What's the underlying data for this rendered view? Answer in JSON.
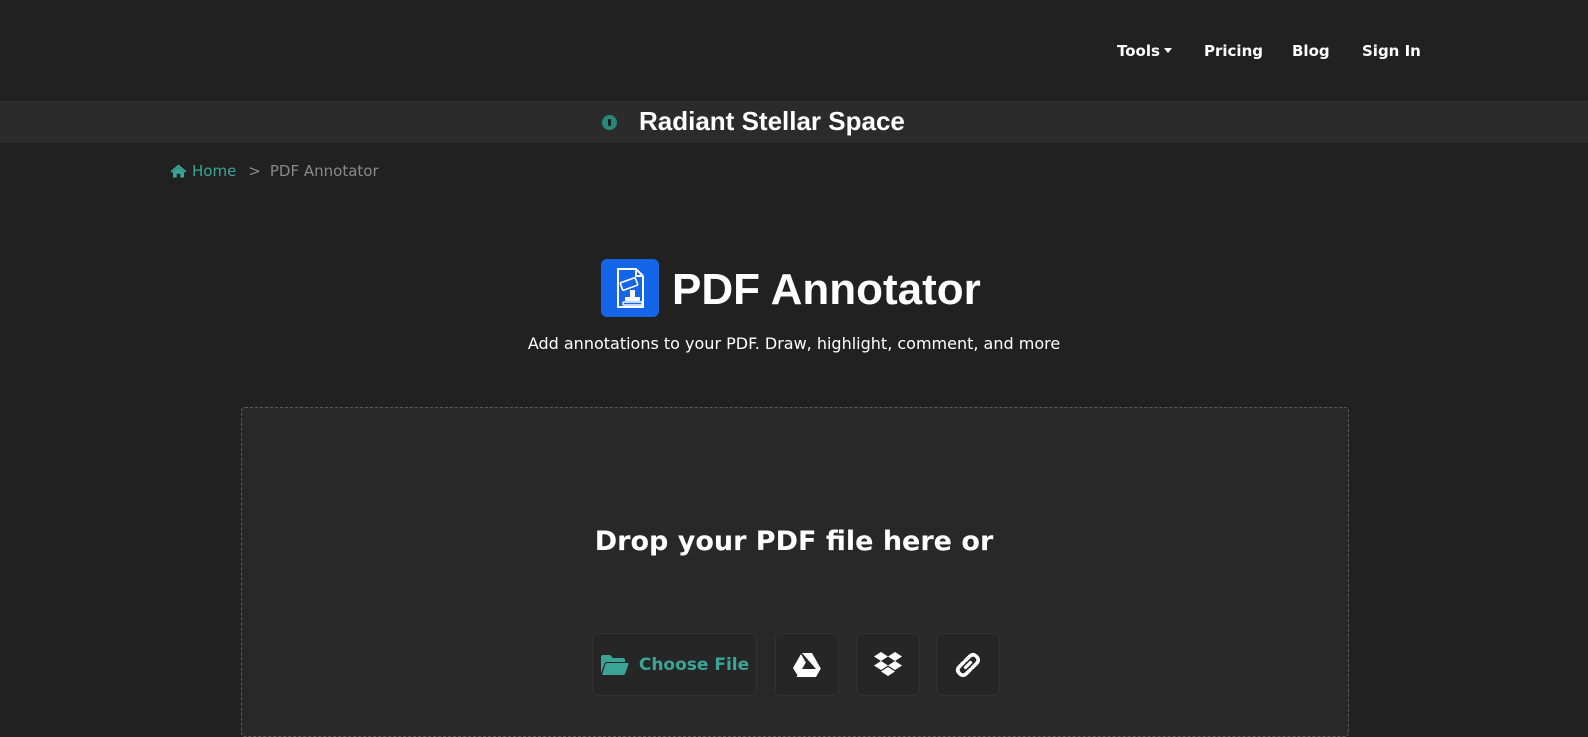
{
  "nav": {
    "tools": "Tools",
    "pricing": "Pricing",
    "blog": "Blog",
    "signin": "Sign In"
  },
  "banner": {
    "title": "Radiant Stellar Space"
  },
  "breadcrumb": {
    "home": "Home",
    "separator": ">",
    "current": "PDF Annotator"
  },
  "hero": {
    "title": "PDF Annotator",
    "subtitle": "Add annotations to your PDF. Draw, highlight, comment, and more",
    "icon": "pdf-annotator-icon"
  },
  "upload": {
    "drop_text": "Drop your PDF file here or",
    "choose_file": "Choose File",
    "sources": [
      "google-drive-icon",
      "dropbox-icon",
      "link-icon"
    ]
  },
  "colors": {
    "background": "#212121",
    "banner": "#2b2b2b",
    "accent": "#3aa597",
    "icon_blue": "#1565e8"
  }
}
